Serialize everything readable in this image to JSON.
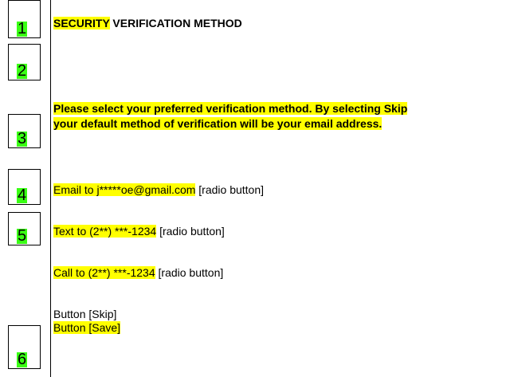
{
  "markers": [
    "1",
    "2",
    "3",
    "4",
    "5",
    "6"
  ],
  "title": {
    "highlight": "SECURITY",
    "rest": " VERIFICATION METHOD"
  },
  "instruction": {
    "line1": "Please select your preferred verification method. By selecting Skip",
    "line2": "your default method of verification will be your email address."
  },
  "options": [
    {
      "label": "Email to j*****oe@gmail.com",
      "control": " [radio button]"
    },
    {
      "label": "Text to (2**) ***-1234",
      "control": " [radio button]"
    },
    {
      "label": "Call to (2**) ***-1234",
      "control": " [radio button]"
    }
  ],
  "buttons": {
    "skip": "Button [Skip]",
    "save": "Button [Save]"
  },
  "colors": {
    "text_highlight": "#ffff00",
    "marker_highlight": "#39ff14"
  }
}
